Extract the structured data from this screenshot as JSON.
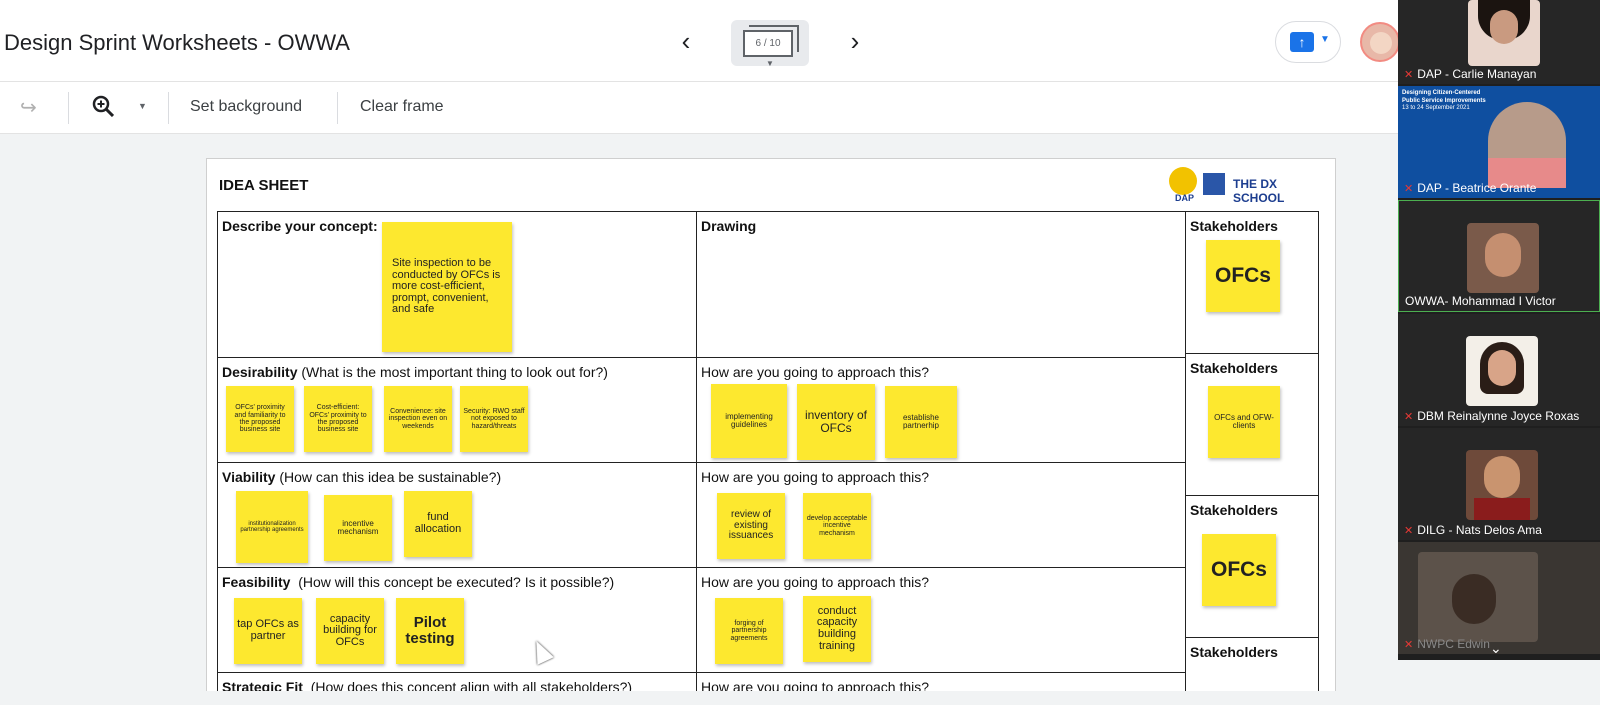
{
  "topbar": {
    "title": "Design Sprint Worksheets - OWWA",
    "prev_icon": "chevron-left-icon",
    "next_icon": "chevron-right-icon",
    "frame_counter": "6 / 10",
    "share_icon": "present-icon"
  },
  "toolbar": {
    "redo_icon": "redo-icon",
    "zoom_icon": "zoom-in-icon",
    "set_background": "Set background",
    "clear_frame": "Clear frame"
  },
  "sheet": {
    "title": "IDEA SHEET",
    "logo_text": "THE DX SCHOOL",
    "logo_dap": "DAP",
    "concept_label": "Describe your concept:",
    "concept_note": "Site inspection to be conducted by OFCs is more cost-efficient, prompt, convenient, and safe",
    "drawing_label": "Drawing",
    "desirability_title": "Desirability",
    "desirability_q": "(What is the most important thing to look out for?)",
    "desirability_notes": [
      "OFCs' proximity and familiarity to the proposed business site",
      "Cost-efficient: OFCs' proximity to the proposed business site",
      "Convenience: site inspection even on weekends",
      "Security: RWO staff not exposed to hazard/threats"
    ],
    "approach_label": "How are you going to approach this?",
    "desirability_approach": [
      "implementing guidelines",
      "inventory of OFCs",
      "establishe partnerhip"
    ],
    "viability_title": "Viability",
    "viability_q": "(How can this idea be sustainable?)",
    "viability_notes": [
      "institutionalization partnership agreements",
      "incentive mechanism",
      "fund allocation"
    ],
    "viability_approach": [
      "review of existing issuances",
      "develop acceptable incentive mechanism"
    ],
    "feasibility_title": "Feasibility",
    "feasibility_q": "(How will this concept be executed? Is it possible?)",
    "feasibility_notes": [
      "tap OFCs as partner",
      "capacity building for OFCs",
      "Pilot testing"
    ],
    "feasibility_approach": [
      "forging of partnership agreements",
      "conduct capacity building training"
    ],
    "strategic_title": "Strategic Fit",
    "strategic_q": "(How does this concept align with all stakeholders?)",
    "stakeholders_label": "Stakeholders",
    "stakeholder_notes": [
      "OFCs",
      "OFCs and OFW-clients",
      "OFCs"
    ]
  },
  "participants": [
    {
      "name": "DAP - Carlie Manayan",
      "muted": true
    },
    {
      "name": "DAP - Beatrice Orante",
      "muted": true
    },
    {
      "name": "OWWA- Mohammad I Victor",
      "muted": false
    },
    {
      "name": "DBM Reinalynne Joyce Roxas",
      "muted": true
    },
    {
      "name": "DILG - Nats Delos Ama",
      "muted": true
    },
    {
      "name": "NWPC Edwin",
      "muted": true
    }
  ],
  "slide_banner": {
    "line1": "Designing Citizen-Centered",
    "line2": "Public Service Improvements",
    "line3": "13 to 24 September 2021"
  },
  "colors": {
    "sticky": "#fde82f",
    "accent": "#1a73e8"
  }
}
